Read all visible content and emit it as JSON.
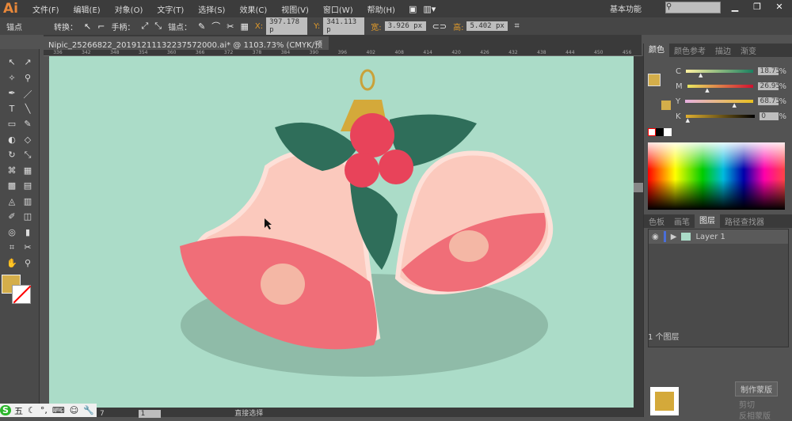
{
  "app": {
    "logo": "Ai",
    "menus": [
      "文件(F)",
      "编辑(E)",
      "对象(O)",
      "文字(T)",
      "选择(S)",
      "效果(C)",
      "视图(V)",
      "窗口(W)",
      "帮助(H)"
    ],
    "workspace": "基本功能",
    "search_placeholder": ""
  },
  "control": {
    "mode": "锚点",
    "convert_label": "转换：",
    "handle_label": "手柄：",
    "anchor_label": "锚点：",
    "x_label": "X:",
    "x_value": "397.178 p",
    "y_label": "Y:",
    "y_value": "341.113 p",
    "w_label": "宽:",
    "w_value": "3.926 px",
    "h_label": "高:",
    "h_value": "5.402 px"
  },
  "document": {
    "tab_title": "Nipic_25266822_20191211132237572000.ai* @ 1103.73% (CMYK/预览)",
    "close": "×",
    "ruler_ticks": [
      "336",
      "342",
      "348",
      "354",
      "360",
      "366",
      "372",
      "378",
      "384",
      "390",
      "396",
      "402",
      "408",
      "414",
      "420",
      "426",
      "432",
      "438",
      "444",
      "450",
      "456"
    ]
  },
  "color_panel": {
    "tabs": [
      "颜色",
      "颜色参考",
      "描边",
      "渐变"
    ],
    "channels": [
      {
        "label": "C",
        "value": "18.75",
        "percent": 18.75
      },
      {
        "label": "M",
        "value": "26.95",
        "percent": 26.95
      },
      {
        "label": "Y",
        "value": "68.75",
        "percent": 68.75
      },
      {
        "label": "K",
        "value": "0",
        "percent": 0
      }
    ],
    "unit": "%",
    "fill_color": "#d4ae4a"
  },
  "layers_panel": {
    "tabs": [
      "色板",
      "画笔",
      "图层",
      "路径查找器"
    ],
    "layers": [
      {
        "name": "Layer 1"
      }
    ],
    "count": "1 个图层"
  },
  "transparency_panel": {
    "make_mask": "制作蒙版",
    "clip": "剪切",
    "invert": "反相蒙版"
  },
  "status": {
    "zoom_suffix": "7",
    "page": "1",
    "tool": "直接选择"
  },
  "ime": {
    "items": [
      "五"
    ]
  },
  "colors": {
    "canvas": "#abdcc8",
    "bell": "#f6b6aa",
    "bell_inner": "#f0606c",
    "leaf": "#2f6e5a",
    "berry": "#e8435a",
    "cap": "#d4a93a"
  }
}
